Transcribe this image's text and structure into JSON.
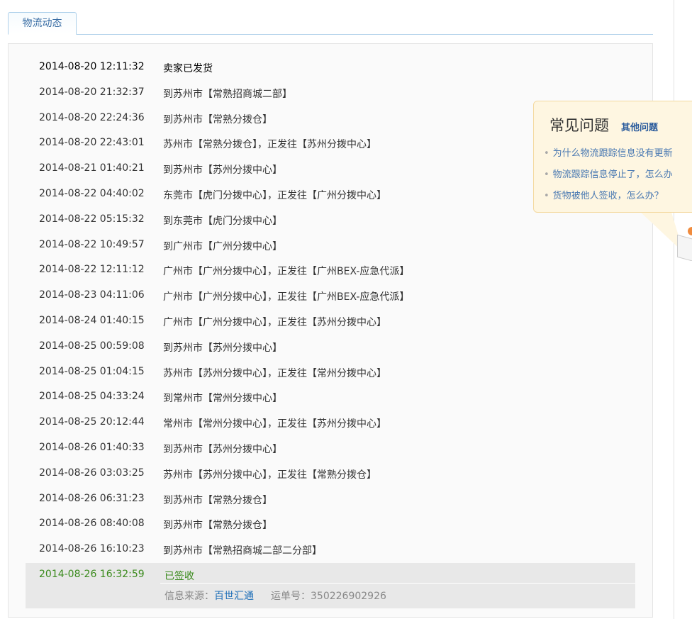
{
  "tab": {
    "label": "物流动态"
  },
  "tracking": [
    {
      "time": "2014-08-20 12:11:32",
      "desc": "卖家已发货"
    },
    {
      "time": "2014-08-20 21:32:37",
      "desc": "到苏州市【常熟招商城二部】"
    },
    {
      "time": "2014-08-20 22:24:36",
      "desc": "到苏州市【常熟分拨仓】"
    },
    {
      "time": "2014-08-20 22:43:01",
      "desc": "苏州市【常熟分拨仓】，正发往【苏州分拨中心】"
    },
    {
      "time": "2014-08-21 01:40:21",
      "desc": "到苏州市【苏州分拨中心】"
    },
    {
      "time": "2014-08-22 04:40:02",
      "desc": "东莞市【虎门分拨中心】，正发往【广州分拨中心】"
    },
    {
      "time": "2014-08-22 05:15:32",
      "desc": "到东莞市【虎门分拨中心】"
    },
    {
      "time": "2014-08-22 10:49:57",
      "desc": "到广州市【广州分拨中心】"
    },
    {
      "time": "2014-08-22 12:11:12",
      "desc": "广州市【广州分拨中心】，正发往【广州BEX-应急代派】"
    },
    {
      "time": "2014-08-23 04:11:06",
      "desc": "广州市【广州分拨中心】，正发往【广州BEX-应急代派】"
    },
    {
      "time": "2014-08-24 01:40:15",
      "desc": "广州市【广州分拨中心】，正发往【苏州分拨中心】"
    },
    {
      "time": "2014-08-25 00:59:08",
      "desc": "到苏州市【苏州分拨中心】"
    },
    {
      "time": "2014-08-25 01:04:15",
      "desc": "苏州市【苏州分拨中心】，正发往【常州分拨中心】"
    },
    {
      "time": "2014-08-25 04:33:24",
      "desc": "到常州市【常州分拨中心】"
    },
    {
      "time": "2014-08-25 20:12:44",
      "desc": "常州市【常州分拨中心】，正发往【苏州分拨中心】"
    },
    {
      "time": "2014-08-26 01:40:33",
      "desc": "到苏州市【苏州分拨中心】"
    },
    {
      "time": "2014-08-26 03:03:25",
      "desc": "苏州市【苏州分拨中心】，正发往【常熟分拨仓】"
    },
    {
      "time": "2014-08-26 06:31:23",
      "desc": "到苏州市【常熟分拨仓】"
    },
    {
      "time": "2014-08-26 08:40:08",
      "desc": "到苏州市【常熟分拨仓】"
    },
    {
      "time": "2014-08-26 16:10:23",
      "desc": "到苏州市【常熟招商城二部二分部】"
    }
  ],
  "signed": {
    "time": "2014-08-26 16:32:59",
    "desc": "已签收",
    "source_label": "信息来源：",
    "source_name": "百世汇通",
    "waybill_label": "运单号：",
    "waybill_no": "350226902926",
    "color": "#3a8a1c"
  },
  "faq": {
    "title": "常见问题",
    "more_link": "其他问题",
    "items": [
      "为什么物流跟踪信息没有更新",
      "物流跟踪信息停止了，怎么办",
      "货物被他人签收，怎么办？"
    ]
  },
  "colors": {
    "accent": "#3a6ea5",
    "link": "#1f6fb8",
    "faq_bg": "#fef6e1"
  }
}
